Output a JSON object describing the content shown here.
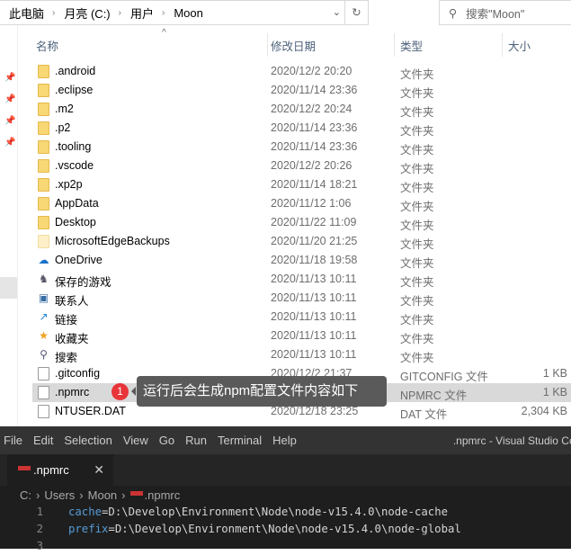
{
  "explorer": {
    "breadcrumb": [
      "此电脑",
      "月亮 (C:)",
      "用户",
      "Moon"
    ],
    "search_placeholder": "搜索\"Moon\"",
    "columns": {
      "name": "名称",
      "date": "修改日期",
      "type": "类型",
      "size": "大小"
    },
    "rows": [
      {
        "name": ".android",
        "date": "2020/12/2 20:20",
        "type": "文件夹",
        "size": "",
        "icon": "folder-icon"
      },
      {
        "name": ".eclipse",
        "date": "2020/11/14 23:36",
        "type": "文件夹",
        "size": "",
        "icon": "folder-icon"
      },
      {
        "name": ".m2",
        "date": "2020/12/2 20:24",
        "type": "文件夹",
        "size": "",
        "icon": "folder-icon"
      },
      {
        "name": ".p2",
        "date": "2020/11/14 23:36",
        "type": "文件夹",
        "size": "",
        "icon": "folder-icon"
      },
      {
        "name": ".tooling",
        "date": "2020/11/14 23:36",
        "type": "文件夹",
        "size": "",
        "icon": "folder-icon"
      },
      {
        "name": ".vscode",
        "date": "2020/12/2 20:26",
        "type": "文件夹",
        "size": "",
        "icon": "folder-icon"
      },
      {
        "name": ".xp2p",
        "date": "2020/11/14 18:21",
        "type": "文件夹",
        "size": "",
        "icon": "folder-icon"
      },
      {
        "name": "AppData",
        "date": "2020/11/12 1:06",
        "type": "文件夹",
        "size": "",
        "icon": "folder-icon"
      },
      {
        "name": "Desktop",
        "date": "2020/11/22 11:09",
        "type": "文件夹",
        "size": "",
        "icon": "folder-icon"
      },
      {
        "name": "MicrosoftEdgeBackups",
        "date": "2020/11/20 21:25",
        "type": "文件夹",
        "size": "",
        "icon": "folder-light-icon"
      },
      {
        "name": "OneDrive",
        "date": "2020/11/18 19:58",
        "type": "文件夹",
        "size": "",
        "icon": "onedrive-icon"
      },
      {
        "name": "保存的游戏",
        "date": "2020/11/13 10:11",
        "type": "文件夹",
        "size": "",
        "icon": "saved-games-icon"
      },
      {
        "name": "联系人",
        "date": "2020/11/13 10:11",
        "type": "文件夹",
        "size": "",
        "icon": "contacts-icon"
      },
      {
        "name": "链接",
        "date": "2020/11/13 10:11",
        "type": "文件夹",
        "size": "",
        "icon": "links-icon"
      },
      {
        "name": "收藏夹",
        "date": "2020/11/13 10:11",
        "type": "文件夹",
        "size": "",
        "icon": "favorites-icon"
      },
      {
        "name": "搜索",
        "date": "2020/11/13 10:11",
        "type": "文件夹",
        "size": "",
        "icon": "search-folder-icon"
      },
      {
        "name": ".gitconfig",
        "date": "2020/12/2 21:37",
        "type": "GITCONFIG 文件",
        "size": "1 KB",
        "icon": "file-icon"
      },
      {
        "name": ".npmrc",
        "date": "",
        "type": "NPMRC 文件",
        "size": "1 KB",
        "icon": "file-icon",
        "selected": true
      },
      {
        "name": "NTUSER.DAT",
        "date": "2020/12/18 23:25",
        "type": "DAT 文件",
        "size": "2,304 KB",
        "icon": "file-icon"
      }
    ]
  },
  "annotation": {
    "badge": "1",
    "text": "运行后会生成npm配置文件内容如下"
  },
  "vscode": {
    "menu": [
      "File",
      "Edit",
      "Selection",
      "View",
      "Go",
      "Run",
      "Terminal",
      "Help"
    ],
    "title": ".npmrc - Visual Studio Code",
    "tab": ".npmrc",
    "breadcrumb": [
      "C:",
      "Users",
      "Moon",
      ".npmrc"
    ],
    "lines": [
      {
        "n": "1",
        "key": "cache",
        "val": "=D:\\Develop\\Environment\\Node\\node-v15.4.0\\node-cache"
      },
      {
        "n": "2",
        "key": "prefix",
        "val": "=D:\\Develop\\Environment\\Node\\node-v15.4.0\\node-global"
      },
      {
        "n": "3",
        "key": "",
        "val": ""
      }
    ]
  }
}
